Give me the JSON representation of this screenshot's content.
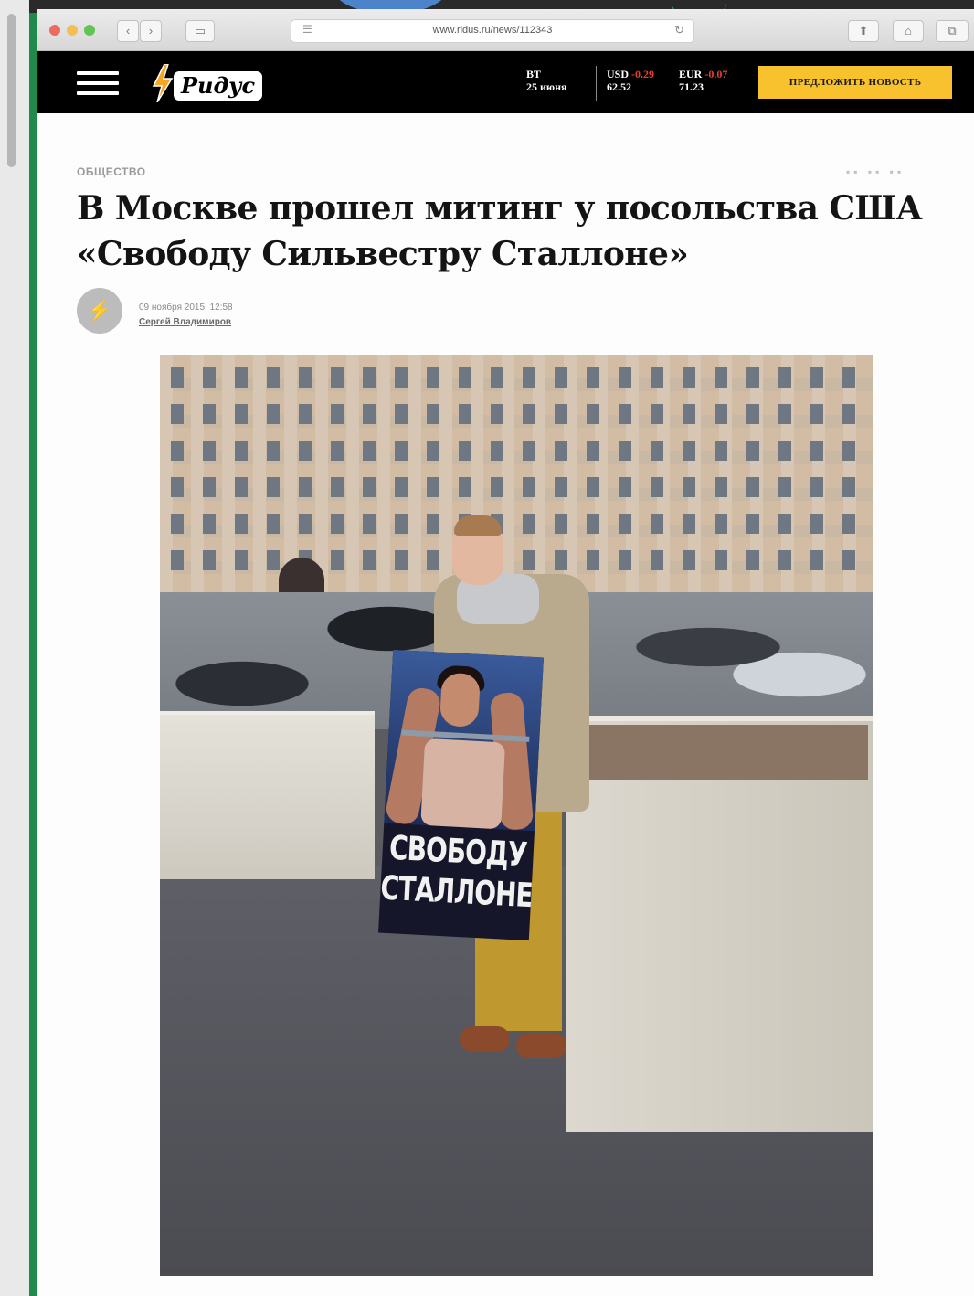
{
  "browser": {
    "url": "www.ridus.ru/news/112343"
  },
  "site": {
    "logo_text": "Ридус",
    "date": {
      "day": "ВТ",
      "date": "25 июня"
    },
    "currency": [
      {
        "code": "USD",
        "change": "-0.29",
        "rate": "62.52"
      },
      {
        "code": "EUR",
        "change": "-0.07",
        "rate": "71.23"
      }
    ],
    "propose_button": "ПРЕДЛОЖИТЬ НОВОСТЬ"
  },
  "article": {
    "category": "ОБЩЕСТВО",
    "title_line1": "В Москве прошел митинг у посольства США",
    "title_line2": "«Свободу Сильвестру Сталлоне»",
    "published": "09 ноября 2015, 12:58",
    "author": "Сергей Владимиров",
    "poster_text_line1": "СВОБОДУ",
    "poster_text_line2": "СТАЛЛОНЕ"
  }
}
